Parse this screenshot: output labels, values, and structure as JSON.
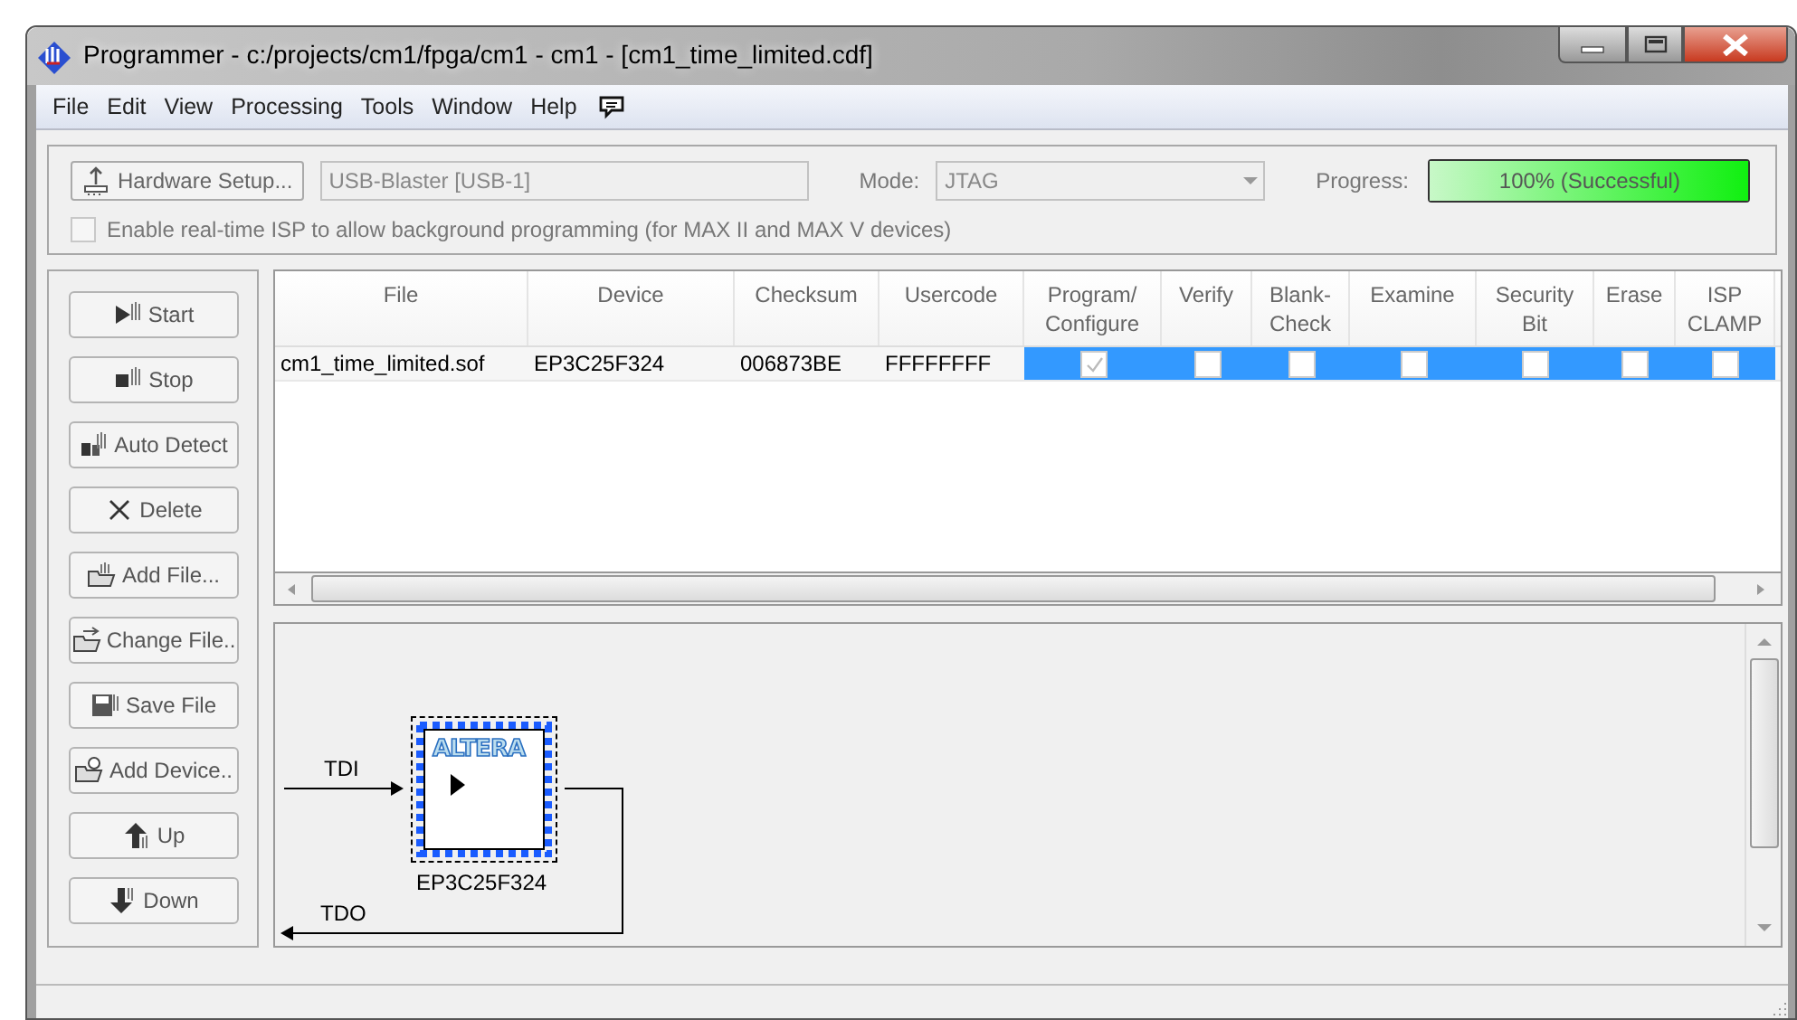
{
  "window": {
    "title": "Programmer - c:/projects/cm1/fpga/cm1 - cm1 - [cm1_time_limited.cdf]"
  },
  "menu": [
    "File",
    "Edit",
    "View",
    "Processing",
    "Tools",
    "Window",
    "Help"
  ],
  "hardware": {
    "button": "Hardware Setup...",
    "value": "USB-Blaster [USB-1]"
  },
  "mode": {
    "label": "Mode:",
    "value": "JTAG"
  },
  "progress": {
    "label": "Progress:",
    "text": "100% (Successful)",
    "level": 1
  },
  "isp": {
    "label": "Enable real-time ISP to allow background programming (for MAX II and MAX V devices)",
    "checked": false
  },
  "actions": [
    {
      "kind": "start",
      "label": "Start"
    },
    {
      "kind": "stop",
      "label": "Stop"
    },
    {
      "kind": "detect",
      "label": "Auto Detect"
    },
    {
      "kind": "delete",
      "label": "Delete"
    },
    {
      "kind": "addfile",
      "label": "Add File..."
    },
    {
      "kind": "changefile",
      "label": "Change File.."
    },
    {
      "kind": "save",
      "label": "Save File"
    },
    {
      "kind": "adddevice",
      "label": "Add Device.."
    },
    {
      "kind": "up",
      "label": "Up"
    },
    {
      "kind": "down",
      "label": "Down"
    }
  ],
  "table": {
    "columns": [
      "File",
      "Device",
      "Checksum",
      "Usercode",
      "Program/\nConfigure",
      "Verify",
      "Blank-\nCheck",
      "Examine",
      "Security\nBit",
      "Erase",
      "ISP\nCLAMP"
    ],
    "rows": [
      {
        "file": "cm1_time_limited.sof",
        "device": "EP3C25F324",
        "checksum": "006873BE",
        "usercode": "FFFFFFFF",
        "selected": true,
        "checks": [
          {
            "checked": true
          },
          {
            "checked": false
          },
          {
            "checked": false
          },
          {
            "checked": false
          },
          {
            "checked": false
          },
          {
            "checked": false
          },
          {
            "checked": false
          }
        ]
      }
    ]
  },
  "chain": {
    "tdi": "TDI",
    "tdo": "TDO",
    "logo": "ALTERA",
    "device": "EP3C25F324"
  }
}
